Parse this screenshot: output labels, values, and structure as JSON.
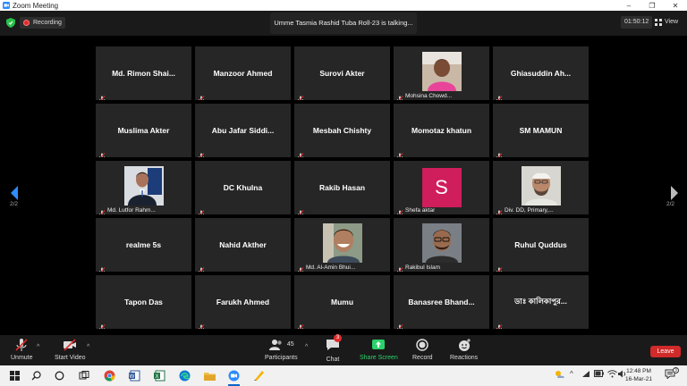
{
  "window": {
    "title": "Zoom Meeting",
    "controls": [
      "–",
      "❐",
      "✕"
    ]
  },
  "topbar": {
    "recording_label": "Recording",
    "talking_banner": "Umme Tasmia Rashid Tuba Roll-23 is talking...",
    "timer": "01:50:12",
    "view_label": "View"
  },
  "gallery": {
    "page_left": "2/2",
    "page_right": "2/2",
    "tiles": [
      {
        "name": "Md. Rimon Shai...",
        "muted": true
      },
      {
        "name": "Manzoor Ahmed",
        "muted": true
      },
      {
        "name": "Surovi Akter",
        "muted": true
      },
      {
        "caption": "Mohsina Chowd...",
        "photo": "woman-pink",
        "muted": true
      },
      {
        "name": "Ghiasuddin Ah...",
        "muted": true
      },
      {
        "name": "Muslima Akter",
        "muted": true
      },
      {
        "name": "Abu Jafar Siddi...",
        "muted": true
      },
      {
        "name": "Mesbah Chishty",
        "muted": true
      },
      {
        "name": "Momotaz khatun",
        "muted": true
      },
      {
        "name": "SM MAMUN",
        "muted": true
      },
      {
        "caption": "Md. Lutfor Rahm...",
        "photo": "man-suit",
        "muted": true
      },
      {
        "name": "DC Khulna",
        "muted": true
      },
      {
        "name": "Rakib Hasan",
        "muted": true
      },
      {
        "caption": "Shefa aktar",
        "letter": "S",
        "muted": true
      },
      {
        "caption": "Div. DD, Primary,...",
        "photo": "man-cap",
        "muted": true
      },
      {
        "name": "realme 5s",
        "muted": true
      },
      {
        "name": "Nahid Akther",
        "muted": true
      },
      {
        "caption": "Md. Al-Amin Bhui...",
        "photo": "man-smile",
        "muted": true
      },
      {
        "caption": "Rakibul Islam",
        "photo": "man-glasses",
        "muted": true
      },
      {
        "name": "Ruhul Quddus",
        "muted": true
      },
      {
        "name": "Tapon Das",
        "muted": true
      },
      {
        "name": "Farukh Ahmed",
        "muted": true
      },
      {
        "name": "Mumu",
        "muted": true
      },
      {
        "name": "Banasree Bhand...",
        "muted": true
      },
      {
        "name": "ডাঃ কালিকাপুর...",
        "muted": true
      }
    ]
  },
  "toolbar": {
    "unmute": "Unmute",
    "start_video": "Start Video",
    "participants": "Participants",
    "participants_count": "45",
    "chat": "Chat",
    "chat_badge": "3",
    "share_screen": "Share Screen",
    "record": "Record",
    "reactions": "Reactions",
    "leave": "Leave"
  },
  "taskbar": {
    "time": "12:48 PM",
    "date": "16-Mar-21",
    "weather_temp": "",
    "apps": [
      "start-icon",
      "search-icon",
      "cortana-icon",
      "taskview-icon",
      "chrome-icon",
      "word-icon",
      "excel-icon",
      "edge-icon",
      "explorer-icon",
      "zoom-icon",
      "paint-icon"
    ]
  },
  "colors": {
    "leave": "#d02a2a",
    "share": "#2bd26b",
    "record_dot": "#e02b2b",
    "tile_bg": "#262626"
  }
}
